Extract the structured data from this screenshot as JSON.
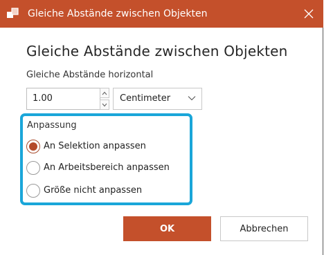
{
  "window": {
    "title": "Gleiche Abstände zwischen Objekten",
    "accent_color": "#c4502b",
    "app_icon": "powerpoint-shapes-icon",
    "close_icon": "close-icon"
  },
  "dialog": {
    "heading": "Gleiche Abstände zwischen Objekten",
    "spacing_label": "Gleiche Abstände horizontal",
    "spacing_value": "1.00",
    "unit_selected": "Centimeter",
    "adjust_group": {
      "label": "Anpassung",
      "highlight_color": "#1aa6d9",
      "options": [
        {
          "label": "An Selektion anpassen",
          "checked": true
        },
        {
          "label": "An Arbeitsbereich anpassen",
          "checked": false
        },
        {
          "label": "Größe nicht anpassen",
          "checked": false
        }
      ]
    },
    "ok_label": "OK",
    "cancel_label": "Abbrechen"
  }
}
